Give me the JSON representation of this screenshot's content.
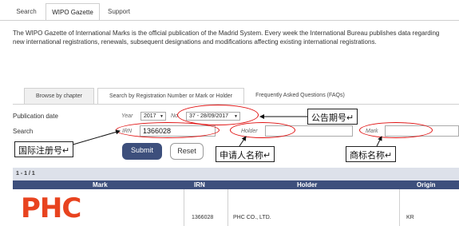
{
  "top_tabs": [
    {
      "label": "Search"
    },
    {
      "label": "WIPO Gazette"
    },
    {
      "label": "Support"
    }
  ],
  "intro": "The WIPO Gazette of International Marks is the official publication of the Madrid System. Every week the International Bureau publishes data regarding new international registrations, renewals, subsequent designations and modifications affecting existing international registrations.",
  "sub_tabs": [
    {
      "label": "Browse by chapter"
    },
    {
      "label": "Search by Registration Number or Mark or Holder"
    },
    {
      "label": "Frequently Asked Questions (FAQs)"
    }
  ],
  "form": {
    "publication_date_label": "Publication date",
    "year_label": "Year",
    "year_value": "2017",
    "no_label": "No",
    "no_value": "37 - 28/09/2017",
    "search_label": "Search",
    "irn_placeholder": "IRN",
    "irn_value": "1366028",
    "holder_placeholder": "Holder",
    "mark_placeholder": "Mark",
    "submit_label": "Submit",
    "reset_label": "Reset"
  },
  "annotations": {
    "issue_number": "公告期号↵",
    "registration_number": "国际注册号↵",
    "applicant_name": "申请人名称↵",
    "mark_name": "商标名称↵"
  },
  "results": {
    "count": "1 - 1 / 1",
    "columns": [
      "Mark",
      "IRN",
      "Holder",
      "Origin"
    ],
    "rows": [
      {
        "mark_logo": "PHC",
        "irn": "1366028",
        "holder": "PHC CO., LTD.",
        "origin": "KR"
      }
    ]
  },
  "colors": {
    "accent": "#3d4f7c",
    "annotation_red": "#e01010",
    "logo_orange": "#e8431f"
  }
}
